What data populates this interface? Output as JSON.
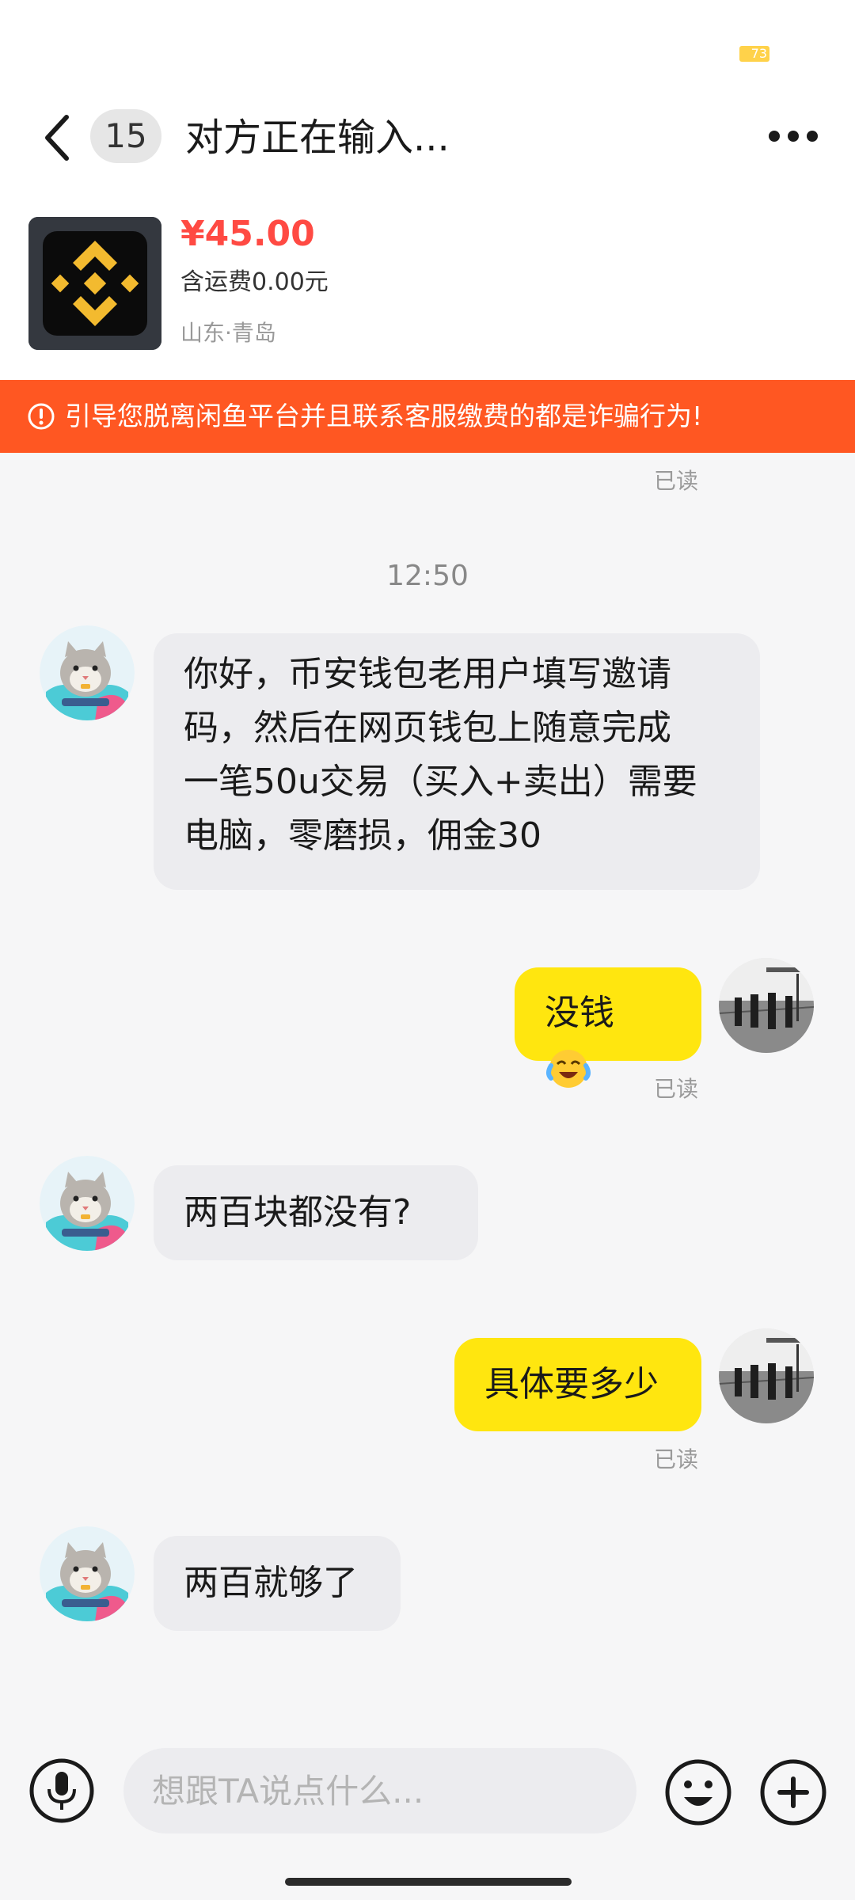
{
  "status_bar": {
    "battery": "73"
  },
  "header": {
    "unread_count": "15",
    "title": "对方正在输入..."
  },
  "product": {
    "price": "¥45.00",
    "shipping": "含运费0.00元",
    "location": "山东·青岛"
  },
  "warning": {
    "text": "引导您脱离闲鱼平台并且联系客服缴费的都是诈骗行为!"
  },
  "messages": {
    "read_label": "已读",
    "time": "12:50",
    "m1": {
      "sender": "other",
      "lines": [
        "你好，币安钱包老用户填写邀请",
        "码，然后在网页钱包上随意完成",
        "一笔50u交易（买入+卖出）需要",
        "电脑，零磨损，佣金30"
      ]
    },
    "m2": {
      "sender": "me",
      "text": "没钱"
    },
    "m3": {
      "sender": "other",
      "text": "两百块都没有?"
    },
    "m4": {
      "sender": "me",
      "text": "具体要多少"
    },
    "m5": {
      "sender": "other",
      "text": "两百就够了"
    }
  },
  "input": {
    "placeholder": "想跟TA说点什么..."
  },
  "colors": {
    "accent_yellow": "#ffe60f",
    "warning_orange": "#ff5722",
    "price_red": "#ff4a43"
  }
}
